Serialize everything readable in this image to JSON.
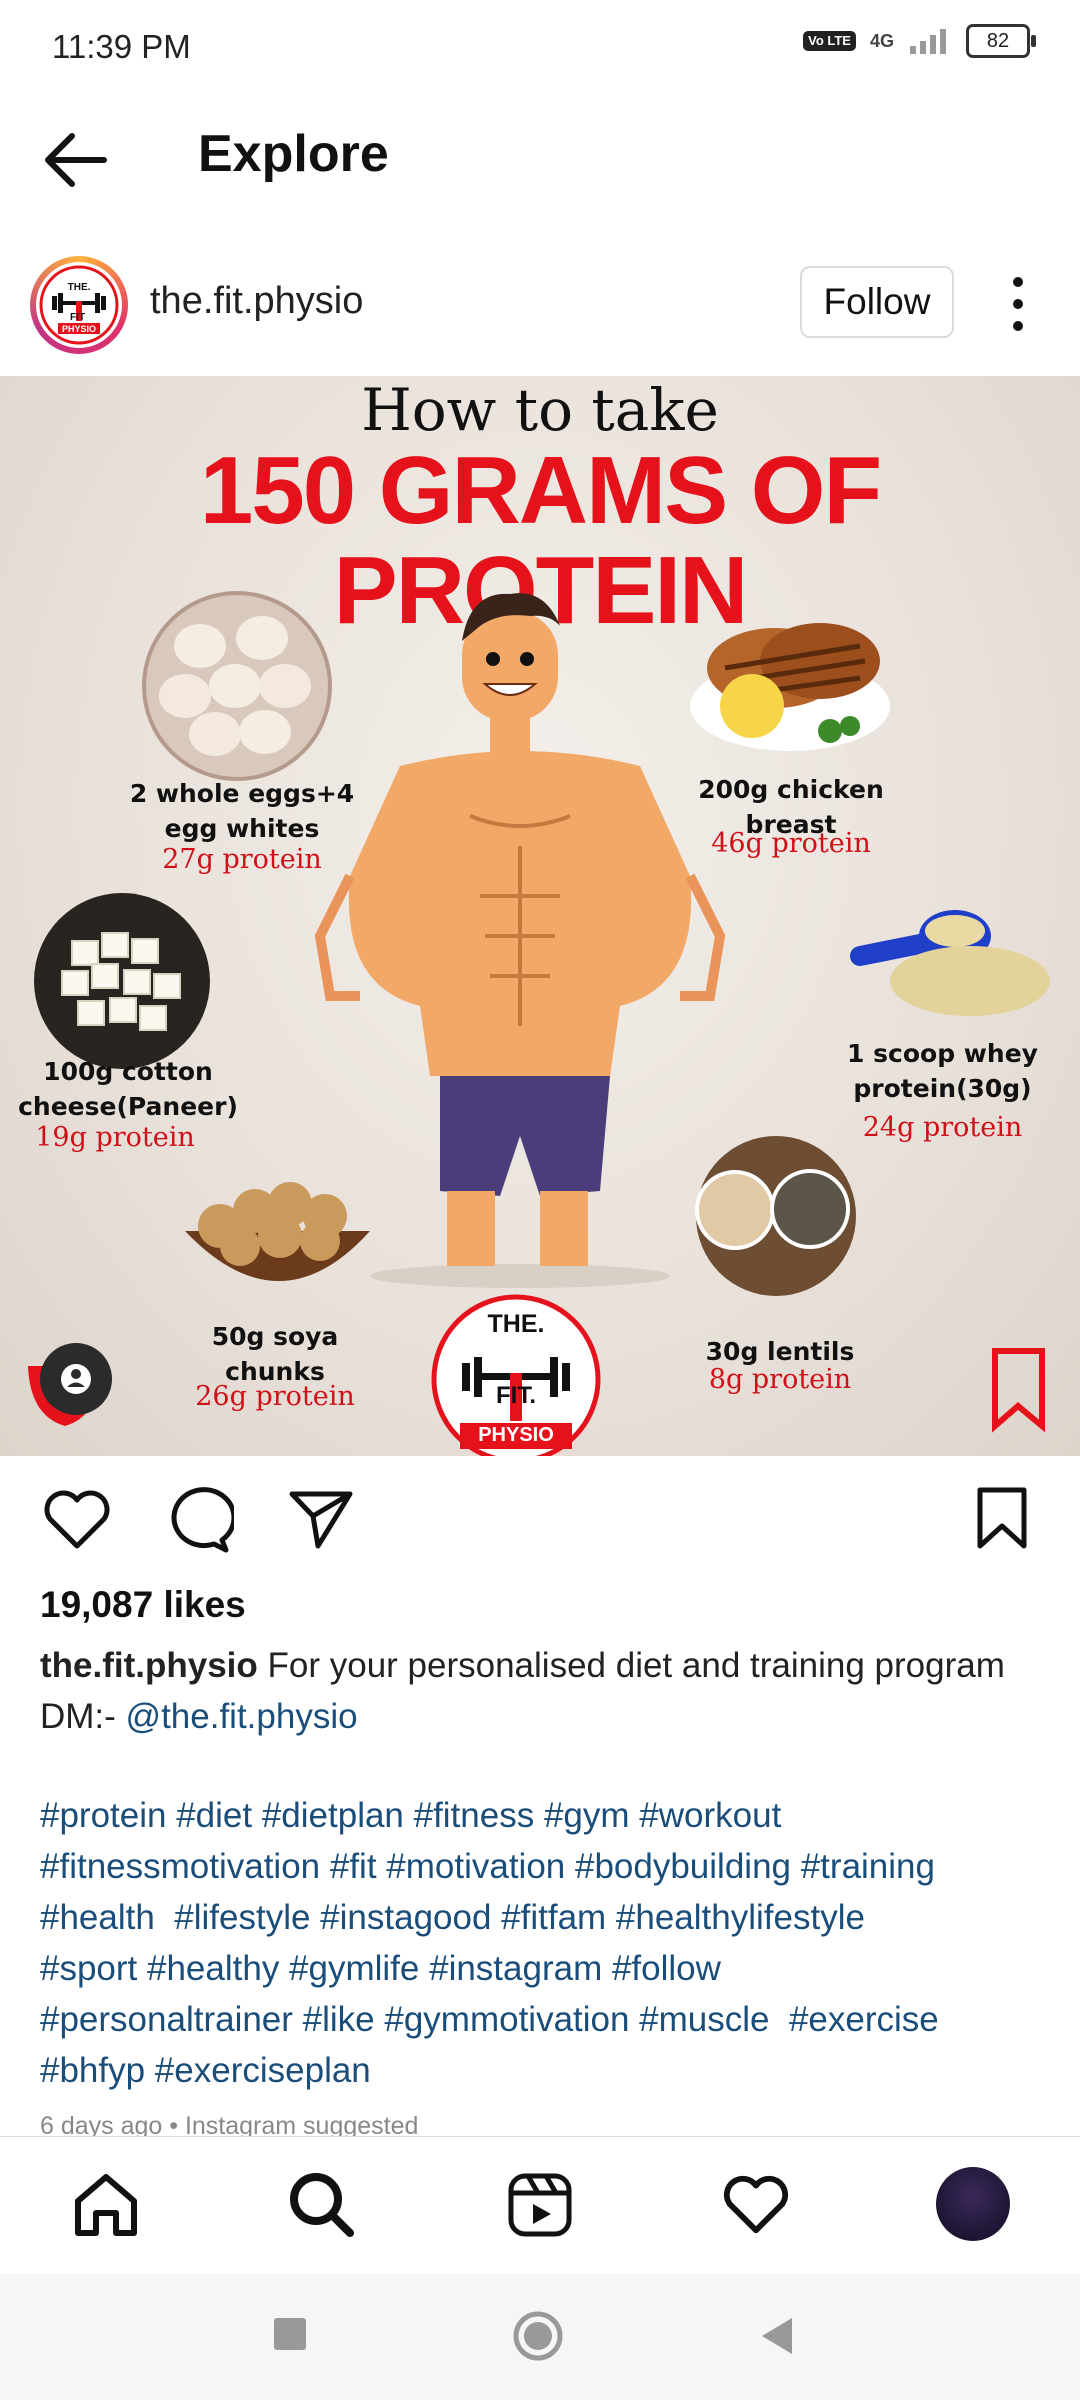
{
  "status": {
    "time": "11:39 PM",
    "volte": "Vo LTE",
    "network": "4G",
    "battery": "82"
  },
  "header": {
    "title": "Explore",
    "back_icon": "arrow-left-icon"
  },
  "post": {
    "username": "the.fit.physio",
    "follow_label": "Follow",
    "avatar_text": {
      "line1": "THE.",
      "line2": "FIT",
      "line3": "PHYSIO"
    },
    "image": {
      "headline_1": "How to take",
      "headline_2": "150 GRAMS OF",
      "headline_3": "PROTEIN",
      "foods": [
        {
          "name": "2 whole eggs+4 egg whites",
          "protein": "27g protein"
        },
        {
          "name": "200g chicken breast",
          "protein": "46g protein"
        },
        {
          "name": "100g cotton cheese(Paneer)",
          "protein": "19g protein"
        },
        {
          "name": "1 scoop whey protein(30g)",
          "protein": "24g protein"
        },
        {
          "name": "50g soya chunks",
          "protein": "26g protein"
        },
        {
          "name": "30g lentils",
          "protein": "8g protein"
        }
      ],
      "logo": {
        "line1": "THE.",
        "line2": "FIT.",
        "line3": "PHYSIO"
      }
    },
    "likes": "19,087 likes",
    "caption": {
      "user": "the.fit.physio",
      "text": " For your personalised diet and training program DM:- ",
      "mention": "@the.fit.physio"
    },
    "hashtags": "#protein #diet #dietplan #fitness #gym #workout\n#fitnessmotivation #fit #motivation #bodybuilding #training\n#health  #lifestyle #instagood #fitfam #healthylifestyle\n#sport #healthy #gymlife #instagram #follow\n#personaltrainer #like #gymmotivation #muscle  #exercise\n#bhfyp #exerciseplan",
    "meta": "6 days ago • Instagram suggested"
  },
  "colors": {
    "accent_red": "#e5121b",
    "link_blue": "#1a4d7a",
    "protein_red": "#d01018"
  }
}
